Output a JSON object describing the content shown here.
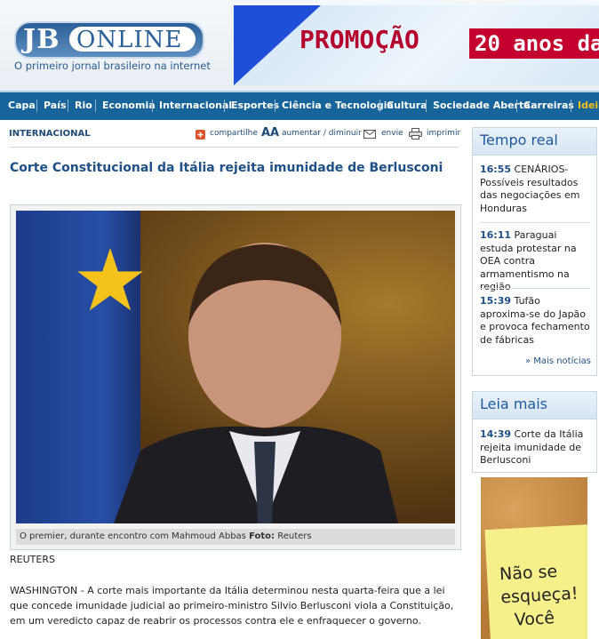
{
  "header": {
    "logo_jb": "JB",
    "logo_online": "ONLINE",
    "tagline": "O primeiro jornal brasileiro na internet",
    "banner_promo": "PROMOÇÃO",
    "banner_anos": "20 anos da"
  },
  "nav": {
    "items": [
      "Capa",
      "País",
      "Rio",
      "Economia",
      "Internacional",
      "Esportes",
      "Ciência e Tecnologia",
      "Cultura",
      "Sociedade Aberta",
      "Carreiras",
      "Ideia"
    ],
    "highlight_color": "#f7c11a"
  },
  "article": {
    "section": "INTERNACIONAL",
    "tools": {
      "share": "compartilhe",
      "font_size": "aumentar / diminuir",
      "send": "envie",
      "print": "imprimir"
    },
    "headline": "Corte Constitucional da Itália rejeita imunidade de Berlusconi",
    "caption_text": "O premier, durante encontro com Mahmoud Abbas",
    "caption_label": "Foto:",
    "caption_credit": "Reuters",
    "source": "REUTERS",
    "body": "WASHINGTON - A corte mais importante da Itália determinou nesta quarta-feira que a lei que concede imunidade judicial ao primeiro-ministro Silvio Berlusconi viola a Constituição, em um veredicto capaz de reabrir os processos contra ele e enfraquecer o governo."
  },
  "sidebar": {
    "realtime": {
      "title": "Tempo real",
      "items": [
        {
          "time": "16:55",
          "text": "CENÁRIOS- Possíveis resultados das negociações em Honduras"
        },
        {
          "time": "16:11",
          "text": "Paraguai estuda protestar na OEA contra armamentismo na região"
        },
        {
          "time": "15:39",
          "text": "Tufão aproxima-se do Japão e provoca fechamento de fábricas"
        }
      ],
      "more": "» Mais notícias"
    },
    "readmore": {
      "title": "Leia mais",
      "items": [
        {
          "time": "14:39",
          "text": "Corte da Itália rejeita imunidade de Berlusconi"
        }
      ]
    },
    "ad": {
      "lines": [
        "Não se",
        "esqueça!",
        "Você"
      ]
    }
  },
  "colors": {
    "nav_bg": "#17649a",
    "link_blue": "#1e4f86",
    "banner_red": "#c4002f"
  }
}
